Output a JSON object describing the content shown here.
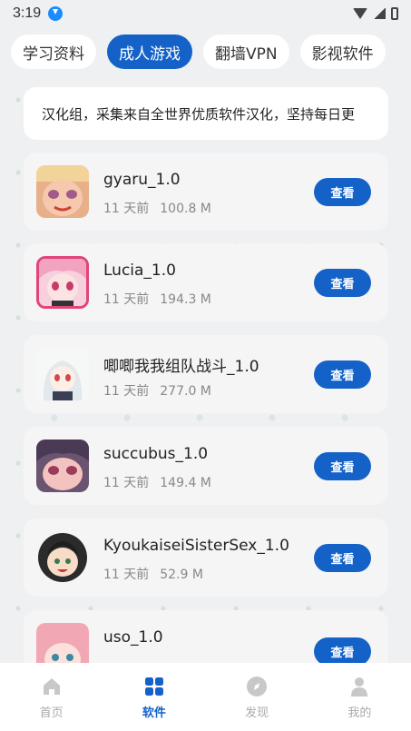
{
  "status_bar": {
    "time": "3:19"
  },
  "tabs": [
    {
      "label": "学习资料"
    },
    {
      "label": "成人游戏"
    },
    {
      "label": "翻墙VPN"
    },
    {
      "label": "影视软件"
    }
  ],
  "notice": {
    "text": "汉化组，采集来自全世界优质软件汉化，坚持每日更"
  },
  "apps": [
    {
      "name": "gyaru_1.0",
      "time": "11 天前",
      "size": "100.8 M",
      "button": "查看"
    },
    {
      "name": "Lucia_1.0",
      "time": "11 天前",
      "size": "194.3 M",
      "button": "查看"
    },
    {
      "name": "唧唧我我组队战斗_1.0",
      "time": "11 天前",
      "size": "277.0 M",
      "button": "查看"
    },
    {
      "name": "succubus_1.0",
      "time": "11 天前",
      "size": "149.4 M",
      "button": "查看"
    },
    {
      "name": "KyoukaiseiSisterSex_1.0",
      "time": "11 天前",
      "size": "52.9 M",
      "button": "查看"
    },
    {
      "name": "uso_1.0",
      "time": "",
      "size": "",
      "button": "查看"
    }
  ],
  "nav": [
    {
      "label": "首页",
      "icon": "home-icon"
    },
    {
      "label": "软件",
      "icon": "apps-grid-icon"
    },
    {
      "label": "发现",
      "icon": "compass-icon"
    },
    {
      "label": "我的",
      "icon": "user-icon"
    }
  ],
  "colors": {
    "accent": "#1462c8",
    "background": "#eef0f2"
  }
}
